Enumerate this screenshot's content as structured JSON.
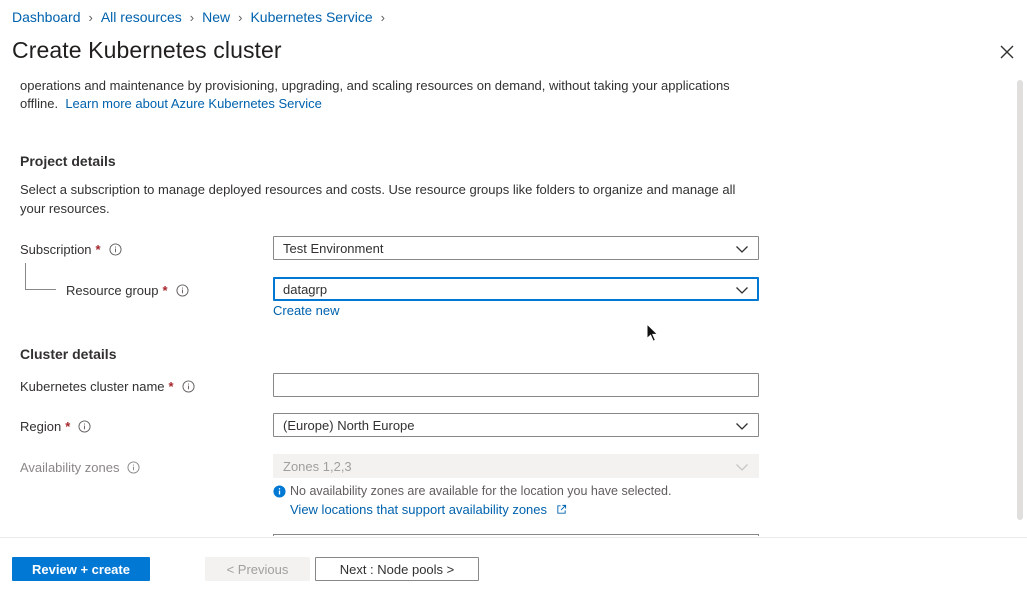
{
  "breadcrumb": [
    {
      "label": "Dashboard"
    },
    {
      "label": "All resources"
    },
    {
      "label": "New"
    },
    {
      "label": "Kubernetes Service"
    }
  ],
  "page": {
    "title": "Create Kubernetes cluster"
  },
  "intro": {
    "text": "operations and maintenance by provisioning, upgrading, and scaling resources on demand, without taking your applications offline.",
    "link": "Learn more about Azure Kubernetes Service"
  },
  "project": {
    "title": "Project details",
    "description": "Select a subscription to manage deployed resources and costs. Use resource groups like folders to organize and manage all your resources.",
    "subscription": {
      "label": "Subscription",
      "value": "Test Environment"
    },
    "resource_group": {
      "label": "Resource group",
      "value": "datagrp",
      "create_new": "Create new"
    }
  },
  "cluster": {
    "title": "Cluster details",
    "name": {
      "label": "Kubernetes cluster name",
      "value": ""
    },
    "region": {
      "label": "Region",
      "value": "(Europe) North Europe"
    },
    "zones": {
      "label": "Availability zones",
      "value": "Zones 1,2,3",
      "notice": "No availability zones are available for the location you have selected.",
      "link": "View locations that support availability zones"
    }
  },
  "footer": {
    "review": "Review + create",
    "previous": "< Previous",
    "next": "Next : Node pools >"
  },
  "colors": {
    "accent": "#0078d4",
    "link": "#0062ad",
    "required": "#a4262c"
  }
}
